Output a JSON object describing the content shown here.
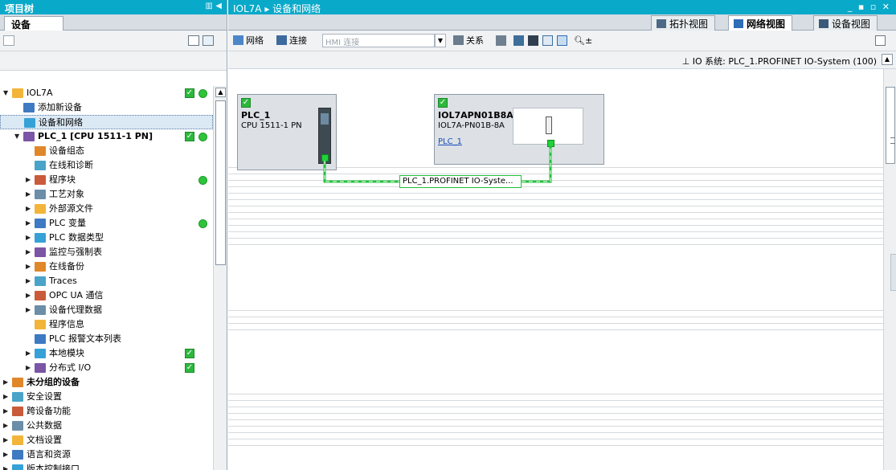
{
  "left_panel": {
    "title": "项目树",
    "tab_label": "设备",
    "tree": [
      {
        "label": "IOL7A",
        "bold": false,
        "level": 0,
        "arrow": "▼",
        "check": true,
        "dot": true
      },
      {
        "label": "添加新设备",
        "bold": false,
        "level": 1,
        "arrow": "",
        "check": false,
        "dot": false
      },
      {
        "label": "设备和网络",
        "bold": false,
        "level": 1,
        "arrow": "",
        "check": false,
        "dot": false
      },
      {
        "label": "PLC_1 [CPU 1511-1 PN]",
        "bold": true,
        "level": 1,
        "arrow": "▼",
        "check": true,
        "dot": true
      },
      {
        "label": "设备组态",
        "bold": false,
        "level": 2,
        "arrow": "",
        "check": false,
        "dot": false
      },
      {
        "label": "在线和诊断",
        "bold": false,
        "level": 2,
        "arrow": "",
        "check": false,
        "dot": false
      },
      {
        "label": "程序块",
        "bold": false,
        "level": 2,
        "arrow": "▶",
        "check": false,
        "dot": true
      },
      {
        "label": "工艺对象",
        "bold": false,
        "level": 2,
        "arrow": "▶",
        "check": false,
        "dot": false
      },
      {
        "label": "外部源文件",
        "bold": false,
        "level": 2,
        "arrow": "▶",
        "check": false,
        "dot": false
      },
      {
        "label": "PLC 变量",
        "bold": false,
        "level": 2,
        "arrow": "▶",
        "check": false,
        "dot": true
      },
      {
        "label": "PLC 数据类型",
        "bold": false,
        "level": 2,
        "arrow": "▶",
        "check": false,
        "dot": false
      },
      {
        "label": "监控与强制表",
        "bold": false,
        "level": 2,
        "arrow": "▶",
        "check": false,
        "dot": false
      },
      {
        "label": "在线备份",
        "bold": false,
        "level": 2,
        "arrow": "▶",
        "check": false,
        "dot": false
      },
      {
        "label": "Traces",
        "bold": false,
        "level": 2,
        "arrow": "▶",
        "check": false,
        "dot": false
      },
      {
        "label": "OPC UA 通信",
        "bold": false,
        "level": 2,
        "arrow": "▶",
        "check": false,
        "dot": false
      },
      {
        "label": "设备代理数据",
        "bold": false,
        "level": 2,
        "arrow": "▶",
        "check": false,
        "dot": false
      },
      {
        "label": "程序信息",
        "bold": false,
        "level": 2,
        "arrow": "",
        "check": false,
        "dot": false
      },
      {
        "label": "PLC 报警文本列表",
        "bold": false,
        "level": 2,
        "arrow": "",
        "check": false,
        "dot": false
      },
      {
        "label": "本地模块",
        "bold": false,
        "level": 2,
        "arrow": "▶",
        "check": true,
        "dot": false
      },
      {
        "label": "分布式 I/O",
        "bold": false,
        "level": 2,
        "arrow": "▶",
        "check": true,
        "dot": false
      },
      {
        "label": "未分组的设备",
        "bold": true,
        "level": 0,
        "arrow": "▶",
        "check": false,
        "dot": false
      },
      {
        "label": "安全设置",
        "bold": false,
        "level": 0,
        "arrow": "▶",
        "check": false,
        "dot": false
      },
      {
        "label": "跨设备功能",
        "bold": false,
        "level": 0,
        "arrow": "▶",
        "check": false,
        "dot": false
      },
      {
        "label": "公共数据",
        "bold": false,
        "level": 0,
        "arrow": "▶",
        "check": false,
        "dot": false
      },
      {
        "label": "文档设置",
        "bold": false,
        "level": 0,
        "arrow": "▶",
        "check": false,
        "dot": false
      },
      {
        "label": "语言和资源",
        "bold": false,
        "level": 0,
        "arrow": "▶",
        "check": false,
        "dot": false
      },
      {
        "label": "版本控制接口",
        "bold": false,
        "level": 0,
        "arrow": "▶",
        "check": false,
        "dot": false
      }
    ]
  },
  "editor": {
    "breadcrumb": "IOL7A ▸ 设备和网络",
    "view_tabs": [
      {
        "label": "拓扑视图",
        "active": false
      },
      {
        "label": "网络视图",
        "active": true
      },
      {
        "label": "设备视图",
        "active": false
      }
    ],
    "toolbar": {
      "network": "网络",
      "connection": "连接",
      "hmi_connection": "HMI 连接",
      "relation": "关系"
    },
    "io_system": "IO 系统: PLC_1.PROFINET IO-System (100)",
    "devices": {
      "plc": {
        "name": "PLC_1",
        "type": "CPU 1511-1 PN"
      },
      "io": {
        "name": "IOL7APN01B8A",
        "type": "IOL7A-PN01B-8A",
        "link": "PLC_1"
      }
    },
    "network_label": "PLC_1.PROFINET IO-Syste..."
  },
  "colors": {
    "title_bar": "#09a9c9",
    "ok_green": "#2db83d",
    "profinet_green": "#22c13a",
    "link_blue": "#1a4fb8"
  }
}
